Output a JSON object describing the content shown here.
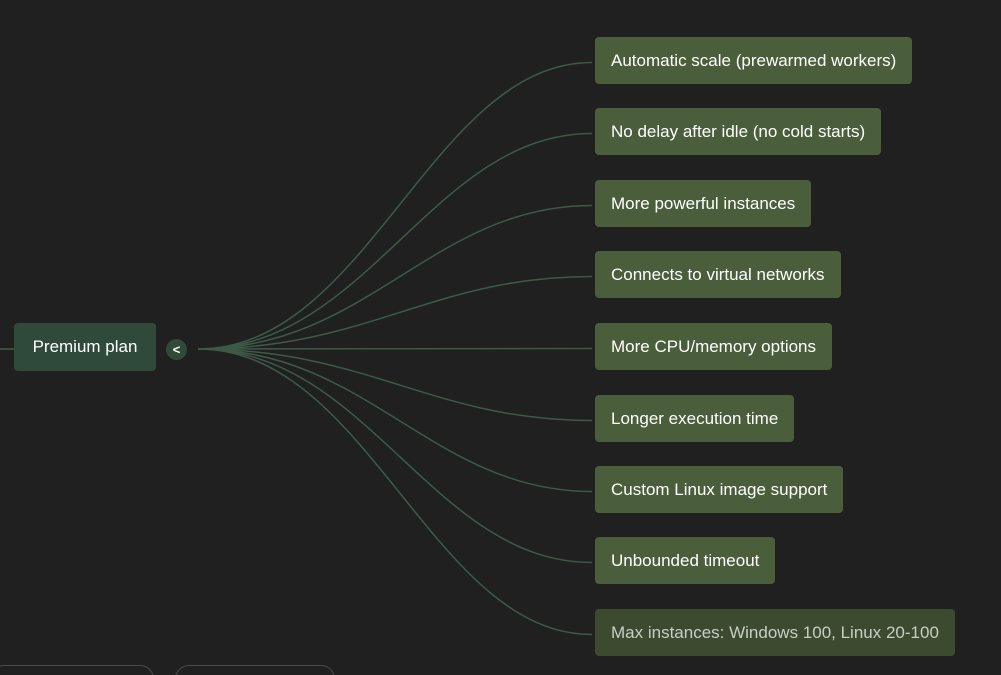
{
  "mindmap": {
    "root": {
      "label": "Premium plan"
    },
    "toggle": {
      "label": "<"
    },
    "children": [
      {
        "label": "Automatic scale (prewarmed workers)"
      },
      {
        "label": "No delay after idle (no cold starts)"
      },
      {
        "label": "More powerful instances"
      },
      {
        "label": "Connects to virtual networks"
      },
      {
        "label": "More CPU/memory options"
      },
      {
        "label": "Longer execution time"
      },
      {
        "label": "Custom Linux image support"
      },
      {
        "label": "Unbounded timeout"
      },
      {
        "label": "Max instances: Windows 100, Linux 20-100"
      }
    ]
  },
  "colors": {
    "background": "#202020",
    "root_fill": "#2f4a3a",
    "child_fill": "#4b5e3c",
    "connector": "#3d5a48"
  }
}
